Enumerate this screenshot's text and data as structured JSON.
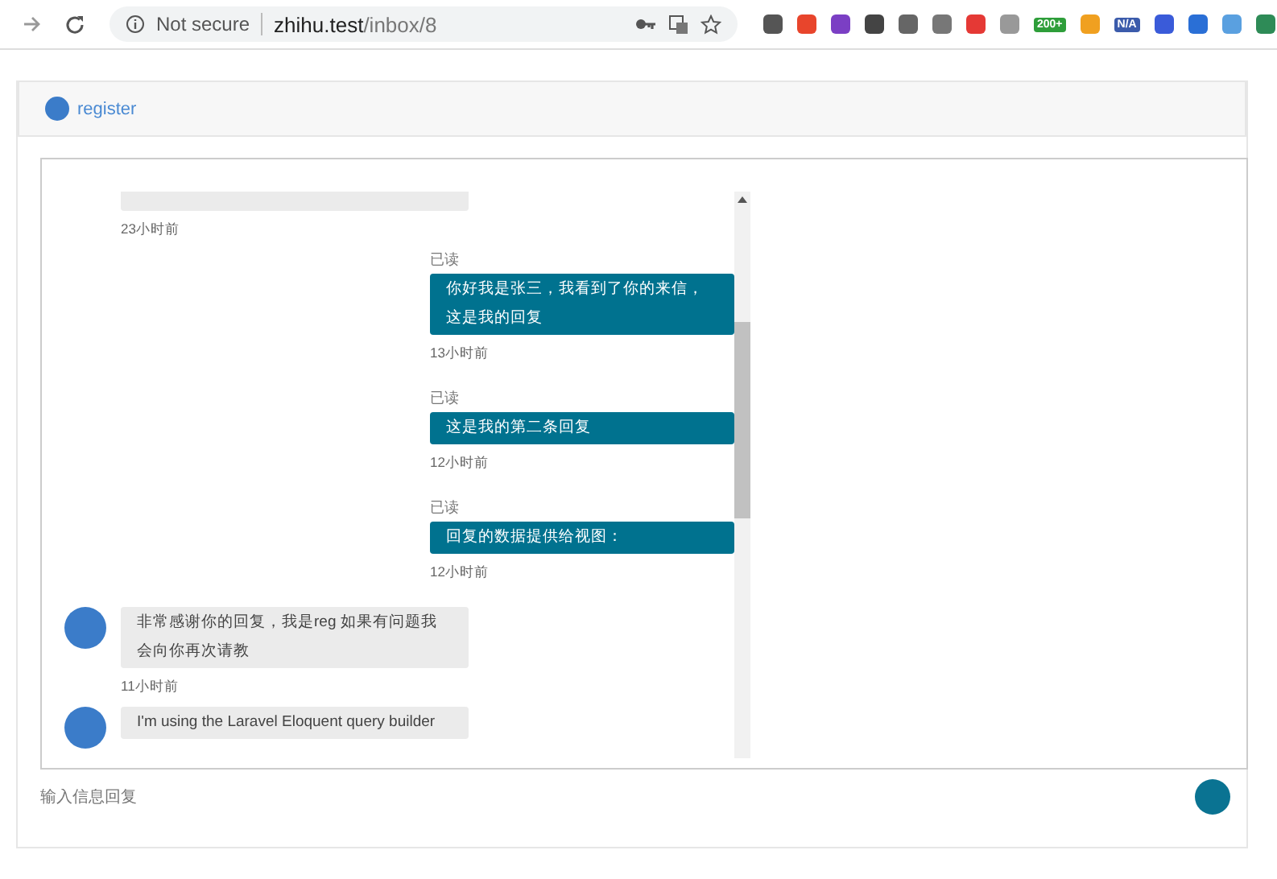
{
  "browser": {
    "security": "Not secure",
    "url_host": "zhihu.test",
    "url_path": "/inbox/8",
    "badges": [
      "200+",
      "N/A"
    ]
  },
  "header": {
    "user": "register"
  },
  "messages": [
    {
      "kind": "partial",
      "time": "23小时前"
    },
    {
      "kind": "sent",
      "status": "已读",
      "text": "你好我是张三，我看到了你的来信，这是我的回复",
      "time": "13小时前"
    },
    {
      "kind": "sent",
      "status": "已读",
      "text": "这是我的第二条回复",
      "time": "12小时前"
    },
    {
      "kind": "sent",
      "status": "已读",
      "text": "回复的数据提供给视图：",
      "time": "12小时前"
    },
    {
      "kind": "received",
      "text": "非常感谢你的回复，我是reg 如果有问题我会向你再次请教",
      "time": "11小时前"
    },
    {
      "kind": "received",
      "text": "I'm using the Laravel Eloquent query builder"
    }
  ],
  "reply": {
    "placeholder": "输入信息回复"
  }
}
